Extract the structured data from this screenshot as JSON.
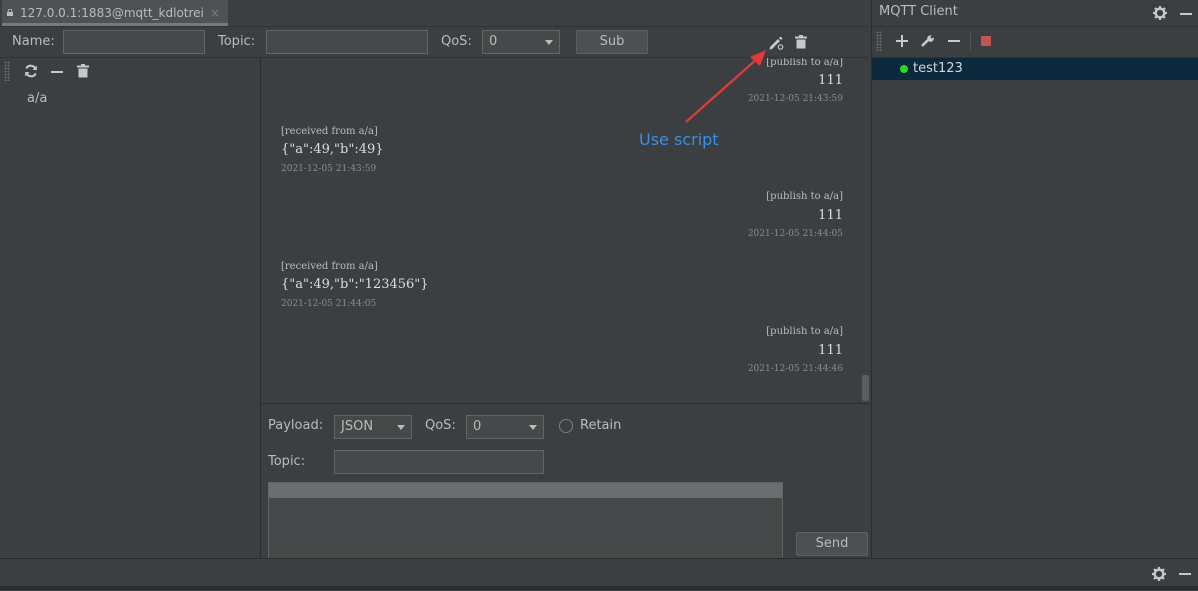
{
  "tab": {
    "label": "127.0.0.1:1883@mqtt_kdlotrei",
    "close": "×"
  },
  "subscribe": {
    "name_label": "Name:",
    "name_value": "",
    "topic_label": "Topic:",
    "topic_value": "",
    "qos_label": "QoS:",
    "qos_value": "0",
    "sub_button": "Sub"
  },
  "topics": [
    "a/a"
  ],
  "messages": [
    {
      "direction": "publish",
      "meta": "[publish to a/a]",
      "body": "111",
      "time": "2021-12-05 21:43:59"
    },
    {
      "direction": "received",
      "meta": "[received from a/a]",
      "body": "{\"a\":49,\"b\":49}",
      "time": "2021-12-05 21:43:59"
    },
    {
      "direction": "publish",
      "meta": "[publish to a/a]",
      "body": "111",
      "time": "2021-12-05 21:44:05"
    },
    {
      "direction": "received",
      "meta": "[received from a/a]",
      "body": "{\"a\":49,\"b\":\"123456\"}",
      "time": "2021-12-05 21:44:05"
    },
    {
      "direction": "publish",
      "meta": "[publish to a/a]",
      "body": "111",
      "time": "2021-12-05 21:44:46"
    }
  ],
  "annotation": {
    "text": "Use script",
    "color": "#3a8ee6",
    "arrow_color": "#e53935"
  },
  "publish": {
    "payload_label": "Payload:",
    "payload_value": "JSON",
    "qos_label": "QoS:",
    "qos_value": "0",
    "retain_label": "Retain",
    "topic_label": "Topic:",
    "topic_value": "",
    "send_button": "Send"
  },
  "right_panel": {
    "title": "MQTT Client",
    "clients": [
      {
        "name": "test123",
        "status_color": "#22dd22"
      }
    ]
  },
  "icons": {
    "settings": "gear-icon",
    "minimize": "minus-icon",
    "add": "plus-icon",
    "edit": "wrench-icon",
    "stop": "stop-icon",
    "refresh": "refresh-icon",
    "delete": "trash-icon",
    "script": "pencil-icon"
  },
  "colors": {
    "background": "#3c3f41",
    "selected_row": "#0d293e",
    "stop": "#c75450"
  }
}
